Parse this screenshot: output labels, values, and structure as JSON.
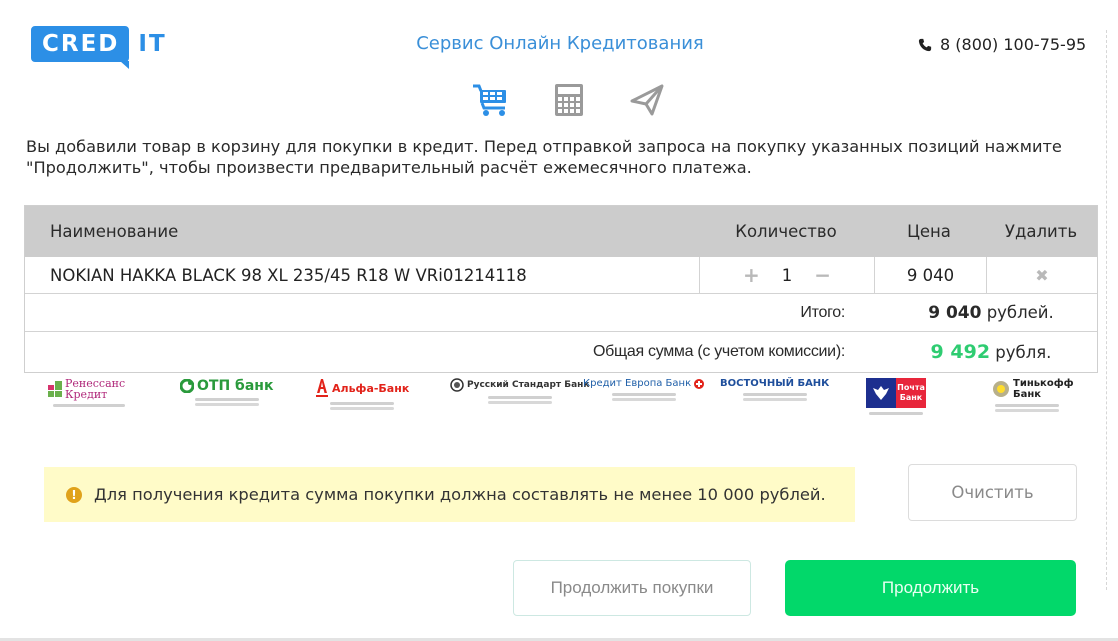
{
  "header": {
    "logo_left": "CRED",
    "logo_right": "IT",
    "title": "Сервис Онлайн Кредитования",
    "phone": "8 (800) 100-75-95",
    "steps": [
      {
        "icon": "cart-icon",
        "active": true
      },
      {
        "icon": "calculator-icon",
        "active": false
      },
      {
        "icon": "paper-plane-icon",
        "active": false
      }
    ]
  },
  "intro": {
    "line1": "Вы добавили товар в корзину для покупки в кредит. Перед отправкой запроса на покупку указанных позиций нажмите",
    "line2": "\"Продолжить\", чтобы произвести предварительный расчёт ежемесячного платежа."
  },
  "cart": {
    "columns": {
      "name": "Наименование",
      "qty": "Количество",
      "price": "Цена",
      "delete": "Удалить"
    },
    "items": [
      {
        "name": "NOKIAN HAKKA BLACK 98 XL 235/45 R18 W VRi01214118",
        "qty": "1",
        "price": "9 040",
        "plus": "+",
        "minus": "−",
        "remove": "✖"
      }
    ],
    "total": {
      "label": "Итого:",
      "value": "9 040",
      "unit": "рублей."
    },
    "grand_total": {
      "label": "Общая сумма (с учетом комиссии):",
      "value": "9 492",
      "unit": "рубля."
    }
  },
  "banks": [
    {
      "name": "Ренессанс Кредит",
      "color": "#b0287a"
    },
    {
      "name": "ОТП банк",
      "color": "#2a9a3c"
    },
    {
      "name": "Альфа-Банк",
      "color": "#e2231a"
    },
    {
      "name": "Русский Стандарт Банк",
      "color": "#333333"
    },
    {
      "name": "Кредит Европа Банк",
      "color": "#1f5fa8"
    },
    {
      "name": "Восточный Банк",
      "color": "#1f4f9c"
    },
    {
      "name": "Почта Банк",
      "color": "#1d2f8f"
    },
    {
      "name": "Тинькофф Банк",
      "color": "#222222"
    }
  ],
  "notice": {
    "icon": "!",
    "text": "Для получения кредита сумма покупки должна составлять не менее 10 000 рублей."
  },
  "buttons": {
    "clear": "Очистить",
    "continue_shopping": "Продолжить покупки",
    "continue": "Продолжить"
  },
  "colors": {
    "brand_blue": "#2c8fe6",
    "success_green": "#02d86a",
    "total_green": "#2ecc71",
    "notice_bg": "#fffbc8"
  }
}
